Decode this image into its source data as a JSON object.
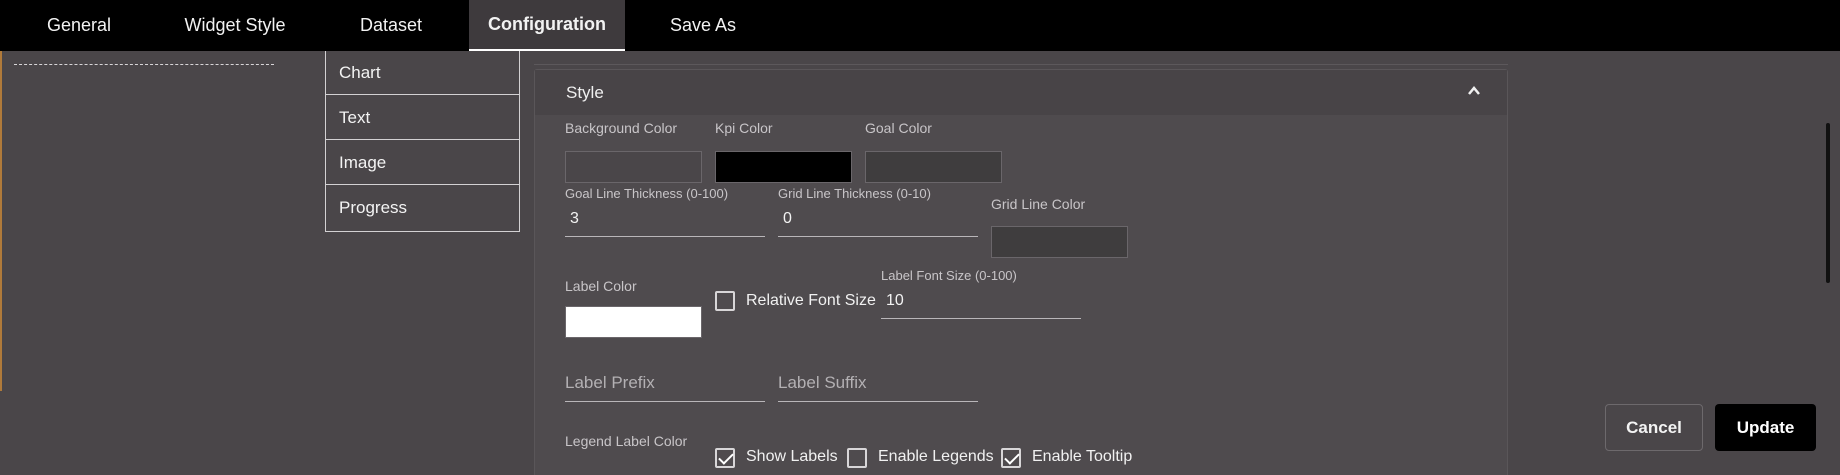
{
  "tabs": [
    {
      "label": "General"
    },
    {
      "label": "Widget Style"
    },
    {
      "label": "Dataset"
    },
    {
      "label": "Configuration"
    },
    {
      "label": "Save As"
    }
  ],
  "menu": [
    "Chart",
    "Text",
    "Image",
    "Progress"
  ],
  "style": {
    "title": "Style",
    "background_color_label": "Background Color",
    "kpi_color_label": "Kpi Color",
    "goal_color_label": "Goal Color",
    "goal_line_thickness_label": "Goal Line Thickness (0-100)",
    "goal_line_thickness_value": "3",
    "grid_line_thickness_label": "Grid Line Thickness (0-10)",
    "grid_line_thickness_value": "0",
    "grid_line_color_label": "Grid Line Color",
    "label_color_label": "Label Color",
    "relative_font_size_label": "Relative Font Size",
    "label_font_size_label": "Label Font Size (0-100)",
    "label_font_size_value": "10",
    "label_prefix_placeholder": "Label Prefix",
    "label_suffix_placeholder": "Label Suffix",
    "legend_label_color_label": "Legend Label Color",
    "show_labels_label": "Show Labels",
    "enable_legends_label": "Enable Legends",
    "enable_tooltip_label": "Enable Tooltip"
  },
  "checkboxes": {
    "relative_font_size": false,
    "show_labels": true,
    "enable_legends": false,
    "enable_tooltip": true
  },
  "colors": {
    "background": "#4a4649",
    "kpi": "#000000",
    "goal": "#3f3d3e",
    "grid_line": "#3f3d3e",
    "label": "#ffffff"
  },
  "buttons": {
    "cancel": "Cancel",
    "update": "Update"
  }
}
